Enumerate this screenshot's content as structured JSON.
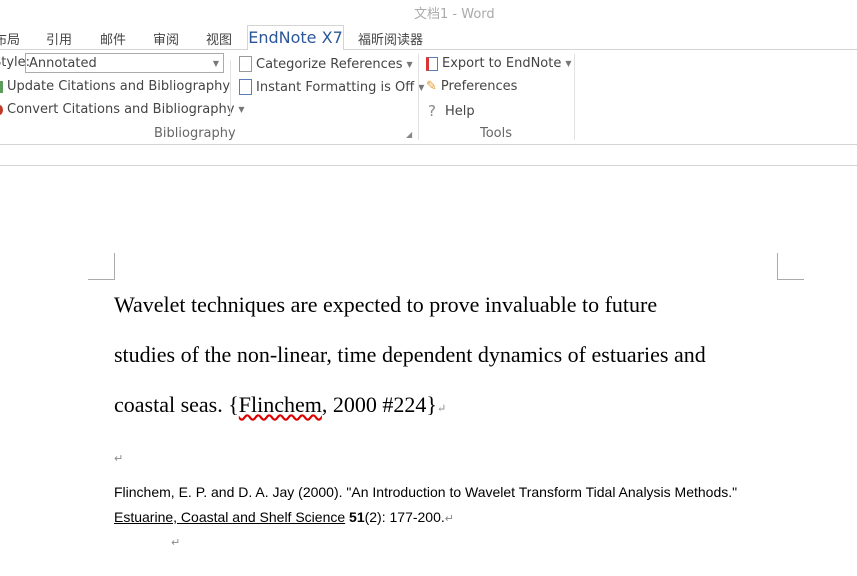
{
  "window": {
    "title": "文档1 - Word"
  },
  "tabs": [
    "布局",
    "引用",
    "邮件",
    "审阅",
    "视图",
    "EndNote X7",
    "福昕阅读器"
  ],
  "active_tab": "EndNote X7",
  "ribbon": {
    "style_label": "Style:",
    "style_value": "Annotated",
    "update": "Update Citations and Bibliography",
    "convert": "Convert Citations and Bibliography",
    "categorize": "Categorize References",
    "instant": "Instant Formatting is Off",
    "bibliography_group": "Bibliography",
    "export": "Export to EndNote",
    "preferences": "Preferences",
    "help": "Help",
    "tools_group": "Tools"
  },
  "document": {
    "lines": [
      "Wavelet techniques are expected to prove invaluable to future",
      "studies of the non-linear, time dependent dynamics of estuaries and",
      "coastal seas. {"
    ],
    "citation_author": "Flinchem",
    "citation_rest": ", 2000 #224}",
    "ref_line1": "Flinchem, E. P. and D. A. Jay (2000). \"An Introduction to Wavelet Transform Tidal Analysis Methods.\"",
    "ref_journal": "Estuarine, Coastal and Shelf Science",
    "ref_volume": "51",
    "ref_tail": "(2): 177-200.",
    "para_mark": "↵"
  }
}
